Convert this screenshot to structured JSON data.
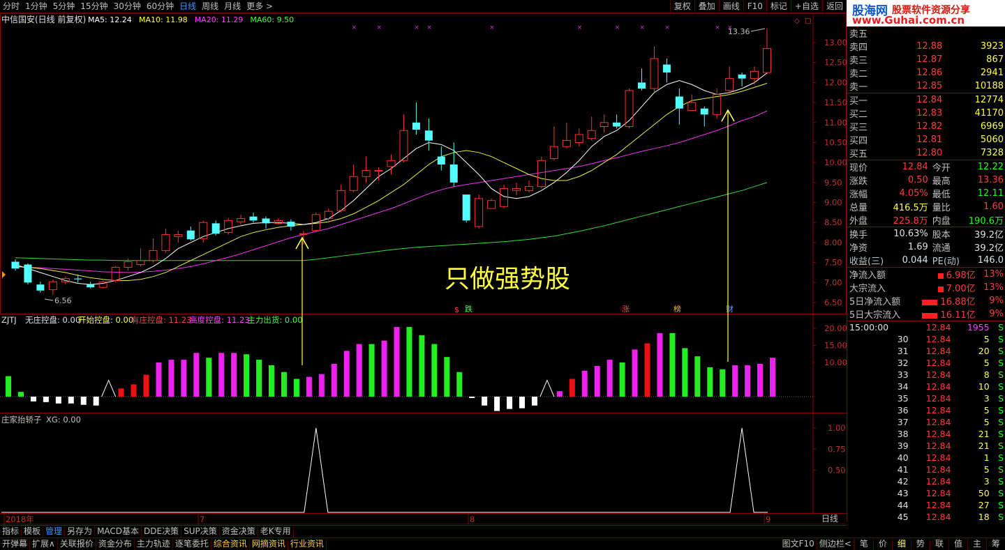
{
  "topbar": {
    "periods": [
      "分时",
      "1分钟",
      "5分钟",
      "15分钟",
      "30分钟",
      "60分钟",
      "日线",
      "周线",
      "月线",
      "更多 >"
    ],
    "active_period": "日线",
    "tools": [
      "复权",
      "叠加",
      "画线",
      "F10",
      "标记",
      "+自选",
      "返回"
    ]
  },
  "logo": {
    "brand": "股海网",
    "slogan": "股票软件资源分享",
    "url": "www.Guhai.com.cn"
  },
  "main_chart": {
    "title": "中信国安(日线 前复权)",
    "ma_labels": [
      {
        "text": "MA5: 12.24",
        "color": "#ffffff"
      },
      {
        "text": "MA10: 11.98",
        "color": "#ffff40"
      },
      {
        "text": "MA20: 11.29",
        "color": "#ff40ff"
      },
      {
        "text": "MA60: 9.50",
        "color": "#40ff40"
      }
    ],
    "y_ticks": [
      "13.00",
      "12.50",
      "12.00",
      "11.50",
      "11.00",
      "10.50",
      "10.00",
      "9.50",
      "9.00",
      "8.50",
      "8.00",
      "7.50",
      "7.00",
      "6.50"
    ],
    "high_label": "13.36",
    "low_label": "6.56",
    "annotation": "只做强势股",
    "event_marks": [
      {
        "text": "跌",
        "color": "#40ff40"
      },
      {
        "text": "涨",
        "color": "#ff4040"
      },
      {
        "text": "榜",
        "color": "#ffaa00"
      },
      {
        "text": "财",
        "color": "#6699ff"
      }
    ],
    "dollar_mark": "$",
    "candles": [
      [
        7.52,
        7.35,
        7.58,
        7.3
      ],
      [
        7.45,
        7.0,
        7.48,
        6.95
      ],
      [
        6.95,
        6.8,
        7.02,
        6.75
      ],
      [
        6.82,
        7.02,
        7.08,
        6.7
      ],
      [
        7.02,
        7.1,
        7.15,
        6.95
      ],
      [
        7.1,
        7.08,
        7.2,
        7.0
      ],
      [
        6.95,
        6.88,
        7.02,
        6.85
      ],
      [
        6.88,
        7.02,
        7.05,
        6.85
      ],
      [
        7.05,
        7.38,
        7.42,
        7.0
      ],
      [
        7.38,
        7.52,
        7.6,
        7.3
      ],
      [
        7.45,
        7.55,
        7.85,
        7.4
      ],
      [
        7.55,
        7.8,
        8.1,
        7.5
      ],
      [
        7.8,
        8.2,
        8.35,
        7.75
      ],
      [
        8.15,
        8.2,
        8.3,
        8.0
      ],
      [
        8.3,
        8.08,
        8.4,
        8.05
      ],
      [
        8.1,
        8.5,
        8.55,
        8.0
      ],
      [
        8.48,
        8.22,
        8.55,
        8.18
      ],
      [
        8.25,
        8.55,
        8.62,
        8.2
      ],
      [
        8.52,
        8.6,
        8.7,
        8.45
      ],
      [
        8.65,
        8.55,
        8.75,
        8.5
      ],
      [
        8.6,
        8.48,
        8.65,
        8.35
      ],
      [
        8.48,
        8.55,
        8.6,
        8.45
      ],
      [
        8.52,
        8.4,
        8.58,
        8.3
      ],
      [
        8.22,
        8.22,
        8.3,
        7.95
      ],
      [
        8.3,
        8.7,
        8.75,
        8.25
      ],
      [
        8.6,
        8.78,
        8.85,
        8.55
      ],
      [
        8.8,
        9.3,
        9.45,
        8.75
      ],
      [
        9.3,
        9.65,
        9.95,
        9.25
      ],
      [
        9.65,
        9.8,
        10.15,
        9.5
      ],
      [
        9.8,
        9.8,
        9.88,
        9.55
      ],
      [
        9.9,
        10.05,
        10.2,
        9.7
      ],
      [
        10.05,
        10.8,
        11.2,
        10.0
      ],
      [
        11.0,
        10.82,
        11.5,
        10.7
      ],
      [
        10.8,
        10.55,
        11.1,
        10.3
      ],
      [
        10.15,
        9.95,
        10.4,
        9.8
      ],
      [
        9.95,
        9.5,
        10.5,
        9.4
      ],
      [
        9.2,
        8.55,
        9.2,
        8.5
      ],
      [
        8.4,
        9.1,
        9.2,
        8.35
      ],
      [
        8.85,
        9.05,
        9.1,
        8.85
      ],
      [
        8.9,
        9.35,
        9.45,
        8.85
      ],
      [
        9.3,
        9.35,
        9.5,
        9.18
      ],
      [
        9.3,
        9.4,
        9.55,
        9.25
      ],
      [
        9.4,
        10.05,
        10.15,
        9.35
      ],
      [
        10.1,
        10.4,
        10.9,
        10.05
      ],
      [
        10.4,
        10.55,
        11.0,
        10.35
      ],
      [
        10.5,
        10.7,
        10.85,
        10.4
      ],
      [
        10.6,
        10.8,
        11.15,
        10.55
      ],
      [
        10.9,
        11.0,
        11.2,
        10.75
      ],
      [
        11.0,
        10.9,
        11.2,
        10.85
      ],
      [
        10.9,
        11.8,
        11.85,
        10.85
      ],
      [
        12.0,
        11.85,
        12.35,
        11.8
      ],
      [
        11.85,
        12.6,
        12.9,
        11.75
      ],
      [
        12.45,
        12.25,
        12.6,
        12.0
      ],
      [
        11.65,
        11.35,
        11.85,
        10.95
      ],
      [
        11.3,
        11.5,
        11.7,
        11.3
      ],
      [
        11.35,
        11.2,
        11.4,
        10.9
      ],
      [
        11.2,
        11.7,
        11.85,
        11.1
      ],
      [
        11.8,
        12.1,
        12.4,
        11.7
      ],
      [
        12.2,
        12.1,
        12.25,
        11.9
      ],
      [
        12.1,
        12.28,
        12.4,
        11.95
      ],
      [
        12.25,
        12.85,
        13.36,
        12.2
      ]
    ],
    "ma5": [
      7.45,
      7.35,
      7.25,
      7.15,
      7.05,
      6.98,
      6.95,
      6.98,
      7.05,
      7.15,
      7.25,
      7.4,
      7.6,
      7.85,
      8.0,
      8.15,
      8.25,
      8.35,
      8.42,
      8.48,
      8.5,
      8.5,
      8.48,
      8.45,
      8.5,
      8.6,
      8.8,
      9.05,
      9.35,
      9.65,
      9.85,
      10.1,
      10.35,
      10.5,
      10.45,
      10.3,
      10.0,
      9.7,
      9.35,
      9.15,
      9.1,
      9.15,
      9.3,
      9.5,
      9.75,
      10.05,
      10.4,
      10.65,
      10.8,
      11.05,
      11.4,
      11.75,
      11.95,
      12.05,
      11.95,
      11.8,
      11.7,
      11.75,
      11.85,
      12.0,
      12.24
    ],
    "ma10": [
      7.4,
      7.38,
      7.35,
      7.3,
      7.25,
      7.18,
      7.12,
      7.08,
      7.05,
      7.05,
      7.08,
      7.15,
      7.25,
      7.4,
      7.55,
      7.7,
      7.85,
      8.0,
      8.15,
      8.25,
      8.32,
      8.38,
      8.42,
      8.45,
      8.48,
      8.52,
      8.6,
      8.72,
      8.88,
      9.05,
      9.25,
      9.45,
      9.7,
      9.95,
      10.15,
      10.25,
      10.3,
      10.25,
      10.15,
      10.0,
      9.85,
      9.7,
      9.6,
      9.55,
      9.55,
      9.65,
      9.8,
      10.0,
      10.2,
      10.45,
      10.7,
      10.95,
      11.2,
      11.4,
      11.55,
      11.6,
      11.65,
      11.7,
      11.78,
      11.88,
      11.98
    ],
    "ma20": [
      7.4,
      7.38,
      7.37,
      7.35,
      7.33,
      7.31,
      7.29,
      7.27,
      7.26,
      7.25,
      7.26,
      7.28,
      7.31,
      7.35,
      7.4,
      7.47,
      7.55,
      7.63,
      7.72,
      7.82,
      7.92,
      8.02,
      8.12,
      8.2,
      8.28,
      8.35,
      8.45,
      8.55,
      8.65,
      8.75,
      8.85,
      8.97,
      9.1,
      9.22,
      9.32,
      9.4,
      9.45,
      9.5,
      9.55,
      9.6,
      9.65,
      9.7,
      9.75,
      9.8,
      9.85,
      9.9,
      9.97,
      10.05,
      10.12,
      10.2,
      10.28,
      10.35,
      10.42,
      10.5,
      10.6,
      10.7,
      10.8,
      10.92,
      11.05,
      11.15,
      11.29
    ],
    "ma60": [
      7.62,
      7.61,
      7.6,
      7.59,
      7.58,
      7.57,
      7.56,
      7.56,
      7.55,
      7.55,
      7.55,
      7.55,
      7.55,
      7.55,
      7.55,
      7.55,
      7.55,
      7.55,
      7.55,
      7.55,
      7.55,
      7.55,
      7.55,
      7.55,
      7.58,
      7.62,
      7.66,
      7.7,
      7.74,
      7.78,
      7.82,
      7.85,
      7.88,
      7.9,
      7.92,
      7.94,
      7.96,
      7.98,
      8.0,
      8.02,
      8.05,
      8.08,
      8.12,
      8.16,
      8.22,
      8.28,
      8.35,
      8.42,
      8.5,
      8.58,
      8.66,
      8.74,
      8.82,
      8.9,
      8.98,
      9.06,
      9.14,
      9.22,
      9.3,
      9.4,
      9.5
    ]
  },
  "zjtj": {
    "name": "ZJTJ",
    "labels": [
      {
        "text": "无庄控盘: 0.00",
        "color": "#e0e0e0"
      },
      {
        "text": "开始控盘: 0.00",
        "color": "#ffff40"
      },
      {
        "text": "有庄控盘: 11.23",
        "color": "#ff4040"
      },
      {
        "text": "高度控盘: 11.23",
        "color": "#ff40ff"
      },
      {
        "text": "主力出货: 0.00",
        "color": "#40ff40"
      }
    ],
    "y_ticks": [
      "20.00",
      "15.00",
      "10.00"
    ],
    "bars": [
      [
        3,
        "g"
      ],
      [
        0.7,
        "g"
      ],
      [
        -0.7,
        "w"
      ],
      [
        -0.8,
        "w"
      ],
      [
        -1.0,
        "w"
      ],
      [
        -1.0,
        "w"
      ],
      [
        -1.2,
        "w"
      ],
      [
        -1.3,
        "w"
      ],
      [
        2.4,
        "tri"
      ],
      [
        1.2,
        "r"
      ],
      [
        1.8,
        "r"
      ],
      [
        3.2,
        "r"
      ],
      [
        5,
        "m"
      ],
      [
        5.4,
        "m"
      ],
      [
        5.4,
        "m"
      ],
      [
        6.4,
        "m"
      ],
      [
        5.7,
        "g"
      ],
      [
        6.4,
        "m"
      ],
      [
        6.4,
        "m"
      ],
      [
        6.2,
        "g"
      ],
      [
        5.4,
        "g"
      ],
      [
        4.6,
        "g"
      ],
      [
        3.6,
        "g"
      ],
      [
        2.6,
        "g"
      ],
      [
        2.9,
        "m"
      ],
      [
        3.3,
        "m"
      ],
      [
        4.8,
        "m"
      ],
      [
        6.7,
        "m"
      ],
      [
        7.7,
        "m"
      ],
      [
        7.7,
        "g"
      ],
      [
        8.2,
        "m"
      ],
      [
        10.2,
        "m"
      ],
      [
        10.2,
        "g"
      ],
      [
        9.0,
        "g"
      ],
      [
        7.7,
        "g"
      ],
      [
        5.8,
        "g"
      ],
      [
        3.6,
        "g"
      ],
      [
        -0.2,
        "w"
      ],
      [
        -1.3,
        "w"
      ],
      [
        -2.1,
        "w"
      ],
      [
        -1.8,
        "w"
      ],
      [
        -1.7,
        "w"
      ],
      [
        -1.3,
        "w"
      ],
      [
        2.4,
        "tri"
      ],
      [
        0.8,
        "m"
      ],
      [
        2.6,
        "r"
      ],
      [
        3.8,
        "m"
      ],
      [
        4.5,
        "m"
      ],
      [
        5.4,
        "m"
      ],
      [
        5.0,
        "g"
      ],
      [
        6.9,
        "m"
      ],
      [
        7.8,
        "r"
      ],
      [
        9.3,
        "m"
      ],
      [
        9.3,
        "g"
      ],
      [
        7.1,
        "g"
      ],
      [
        5.9,
        "g"
      ],
      [
        4.3,
        "g"
      ],
      [
        4.0,
        "g"
      ],
      [
        4.6,
        "m"
      ],
      [
        4.6,
        "m"
      ],
      [
        4.8,
        "m"
      ],
      [
        5.7,
        "m"
      ]
    ]
  },
  "xg": {
    "name": "庄家抬轿子",
    "label": "XG: 0.00",
    "y_ticks": [
      "1.00",
      "0.75",
      "0.50"
    ],
    "spikes": [
      24,
      58
    ]
  },
  "x_axis": {
    "labels": [
      "2018年",
      "7",
      "8",
      "9"
    ],
    "period_button": "日线"
  },
  "order_book": {
    "sells": [
      {
        "label": "卖五",
        "price": "",
        "vol": ""
      },
      {
        "label": "卖四",
        "price": "12.88",
        "vol": "3923"
      },
      {
        "label": "卖三",
        "price": "12.87",
        "vol": "867"
      },
      {
        "label": "卖二",
        "price": "12.86",
        "vol": "2941"
      },
      {
        "label": "卖一",
        "price": "12.85",
        "vol": "10188"
      }
    ],
    "buys": [
      {
        "label": "买一",
        "price": "12.84",
        "vol": "12774"
      },
      {
        "label": "买二",
        "price": "12.83",
        "vol": "41170"
      },
      {
        "label": "买三",
        "price": "12.82",
        "vol": "6969"
      },
      {
        "label": "买四",
        "price": "12.81",
        "vol": "5060"
      },
      {
        "label": "买五",
        "price": "12.80",
        "vol": "7328"
      }
    ]
  },
  "quote": {
    "rows": [
      {
        "l1": "现价",
        "v1": "12.84",
        "c1": "r",
        "l2": "今开",
        "v2": "12.22",
        "c2": "g"
      },
      {
        "l1": "涨跌",
        "v1": "0.50",
        "c1": "r",
        "l2": "最高",
        "v2": "13.36",
        "c2": "r"
      },
      {
        "l1": "涨幅",
        "v1": "4.05%",
        "c1": "r",
        "l2": "最低",
        "v2": "12.11",
        "c2": "g"
      },
      {
        "l1": "总量",
        "v1": "416.5万",
        "c1": "y",
        "l2": "量比",
        "v2": "1.60",
        "c2": "r"
      },
      {
        "l1": "外盘",
        "v1": "225.8万",
        "c1": "r",
        "l2": "内盘",
        "v2": "190.6万",
        "c2": "g"
      }
    ],
    "rows2": [
      {
        "l1": "换手",
        "v1": "10.63%",
        "l2": "股本",
        "v2": "39.2亿"
      },
      {
        "l1": "净资",
        "v1": "1.69",
        "l2": "流通",
        "v2": "39.2亿"
      },
      {
        "l1": "收益(三)",
        "v1": "0.044",
        "l2": "PE(动)",
        "v2": "146.0"
      }
    ]
  },
  "flows": [
    {
      "label": "净流入额",
      "value": "6.98亿",
      "pct": "13%",
      "bar": 8
    },
    {
      "label": "大宗流入",
      "value": "7.00亿",
      "pct": "13%",
      "bar": 8
    },
    {
      "label": "5日净流入额",
      "value": "16.88亿",
      "pct": "9%",
      "bar": 22
    },
    {
      "label": "5日大宗流入",
      "value": "16.11亿",
      "pct": "9%",
      "bar": 22
    }
  ],
  "ticks": {
    "header": {
      "time": "15:00:00",
      "price": "12.84",
      "vol": "1955",
      "side": "S"
    },
    "rows": [
      {
        "t": "30",
        "p": "12.84",
        "v": "5",
        "s": "S"
      },
      {
        "t": "31",
        "p": "12.84",
        "v": "20",
        "s": "S"
      },
      {
        "t": "32",
        "p": "12.84",
        "v": "5",
        "s": "S"
      },
      {
        "t": "33",
        "p": "12.84",
        "v": "8",
        "s": "S"
      },
      {
        "t": "34",
        "p": "12.84",
        "v": "10",
        "s": "S"
      },
      {
        "t": "35",
        "p": "12.84",
        "v": "3",
        "s": "S"
      },
      {
        "t": "36",
        "p": "12.84",
        "v": "5",
        "s": "S"
      },
      {
        "t": "37",
        "p": "12.84",
        "v": "5",
        "s": "S"
      },
      {
        "t": "38",
        "p": "12.84",
        "v": "21",
        "s": "S"
      },
      {
        "t": "39",
        "p": "12.84",
        "v": "21",
        "s": "S"
      },
      {
        "t": "40",
        "p": "12.84",
        "v": "1",
        "s": "S"
      },
      {
        "t": "41",
        "p": "12.84",
        "v": "5",
        "s": "S"
      },
      {
        "t": "42",
        "p": "12.84",
        "v": "3",
        "s": "S"
      },
      {
        "t": "43",
        "p": "12.84",
        "v": "50",
        "s": "S"
      },
      {
        "t": "44",
        "p": "12.84",
        "v": "27",
        "s": "S"
      },
      {
        "t": "45",
        "p": "12.84",
        "v": "18",
        "s": "S"
      }
    ]
  },
  "bottom_bar1": [
    "指标",
    "模板",
    "管理",
    "另存为",
    "MACD基本",
    "DDE决策",
    "SUP决策",
    "资金决策",
    "老K专用"
  ],
  "bottom_bar1_active": "管理",
  "bottom_bar2": [
    "开弹幕",
    "扩展∧",
    "关联报价",
    "资金分布",
    "主力轨迹",
    "逐笔委托",
    "综合资讯",
    "网摘资讯",
    "行业资讯"
  ],
  "bottom_bar2_highlight": [
    "综合资讯",
    "网摘资讯",
    "行业资讯"
  ],
  "bottom_right": [
    "图文F10",
    "侧边栏<"
  ],
  "side_tabs": [
    "笔",
    "价",
    "细",
    "势",
    "联",
    "值",
    "主",
    "筹"
  ],
  "side_tab_active": "细"
}
